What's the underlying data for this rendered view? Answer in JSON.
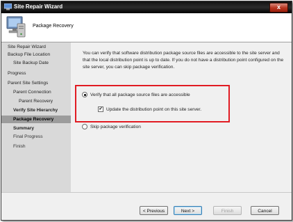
{
  "window": {
    "title": "Site Repair Wizard",
    "close_glyph": "x"
  },
  "header": {
    "heading": "Package Recovery",
    "icon": "computer-wizard-icon"
  },
  "sidebar": {
    "items": [
      {
        "label": "Site Repair Wizard"
      },
      {
        "label": "Backup File Location"
      },
      {
        "label": "Site Backup Date"
      },
      {
        "label": "Progress"
      },
      {
        "label": "Parent Site Settings"
      },
      {
        "label": "Parent Connection"
      },
      {
        "label": "Parent Recovery"
      },
      {
        "label": "Verify Site Hierarchy"
      },
      {
        "label": "Package Recovery"
      },
      {
        "label": "Summary"
      },
      {
        "label": "Final Progress"
      },
      {
        "label": "Finish"
      }
    ]
  },
  "content": {
    "description": "You can verify that software distribution package source files are accessible to the site server and that the local distribution point is up to date. If you do not have a distribution point configured on the site server, you can skip package verification.",
    "option_verify": "Verify that all package source files are accessible",
    "option_update_dp": "Update the distribution point on this site server.",
    "option_skip": "Skip package verification",
    "checkmark": "✔"
  },
  "buttons": {
    "previous": "< Previous",
    "next": "Next >",
    "finish": "Finish",
    "cancel": "Cancel"
  },
  "colors": {
    "highlight_box": "#e11b22",
    "active_nav": "#9c9c9c",
    "sidebar": "#d9d9d9"
  }
}
